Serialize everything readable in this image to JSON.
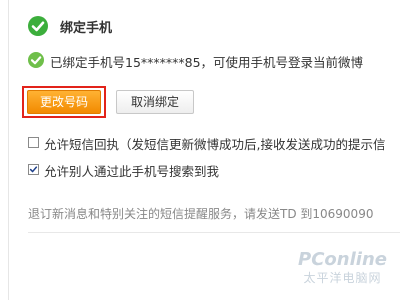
{
  "header": {
    "title": "绑定手机"
  },
  "status": {
    "text": "已绑定手机号15*******85，可使用手机号登录当前微博"
  },
  "buttons": {
    "change": "更改号码",
    "unbind": "取消绑定"
  },
  "options": [
    {
      "label": "允许短信回执（发短信更新微博成功后,接收发送成功的提示信",
      "checked": false
    },
    {
      "label": "允许别人通过此手机号搜索到我",
      "checked": true
    }
  ],
  "info": {
    "text": "退订新消息和特别关注的短信提醒服务，请发送TD 到10690090"
  },
  "watermark": {
    "logo": "PConline",
    "sub": "太平洋电脑网"
  },
  "colors": {
    "success_green": "#3cae3c",
    "accent_orange": "#f28a00",
    "highlight_red": "#e2231a"
  }
}
